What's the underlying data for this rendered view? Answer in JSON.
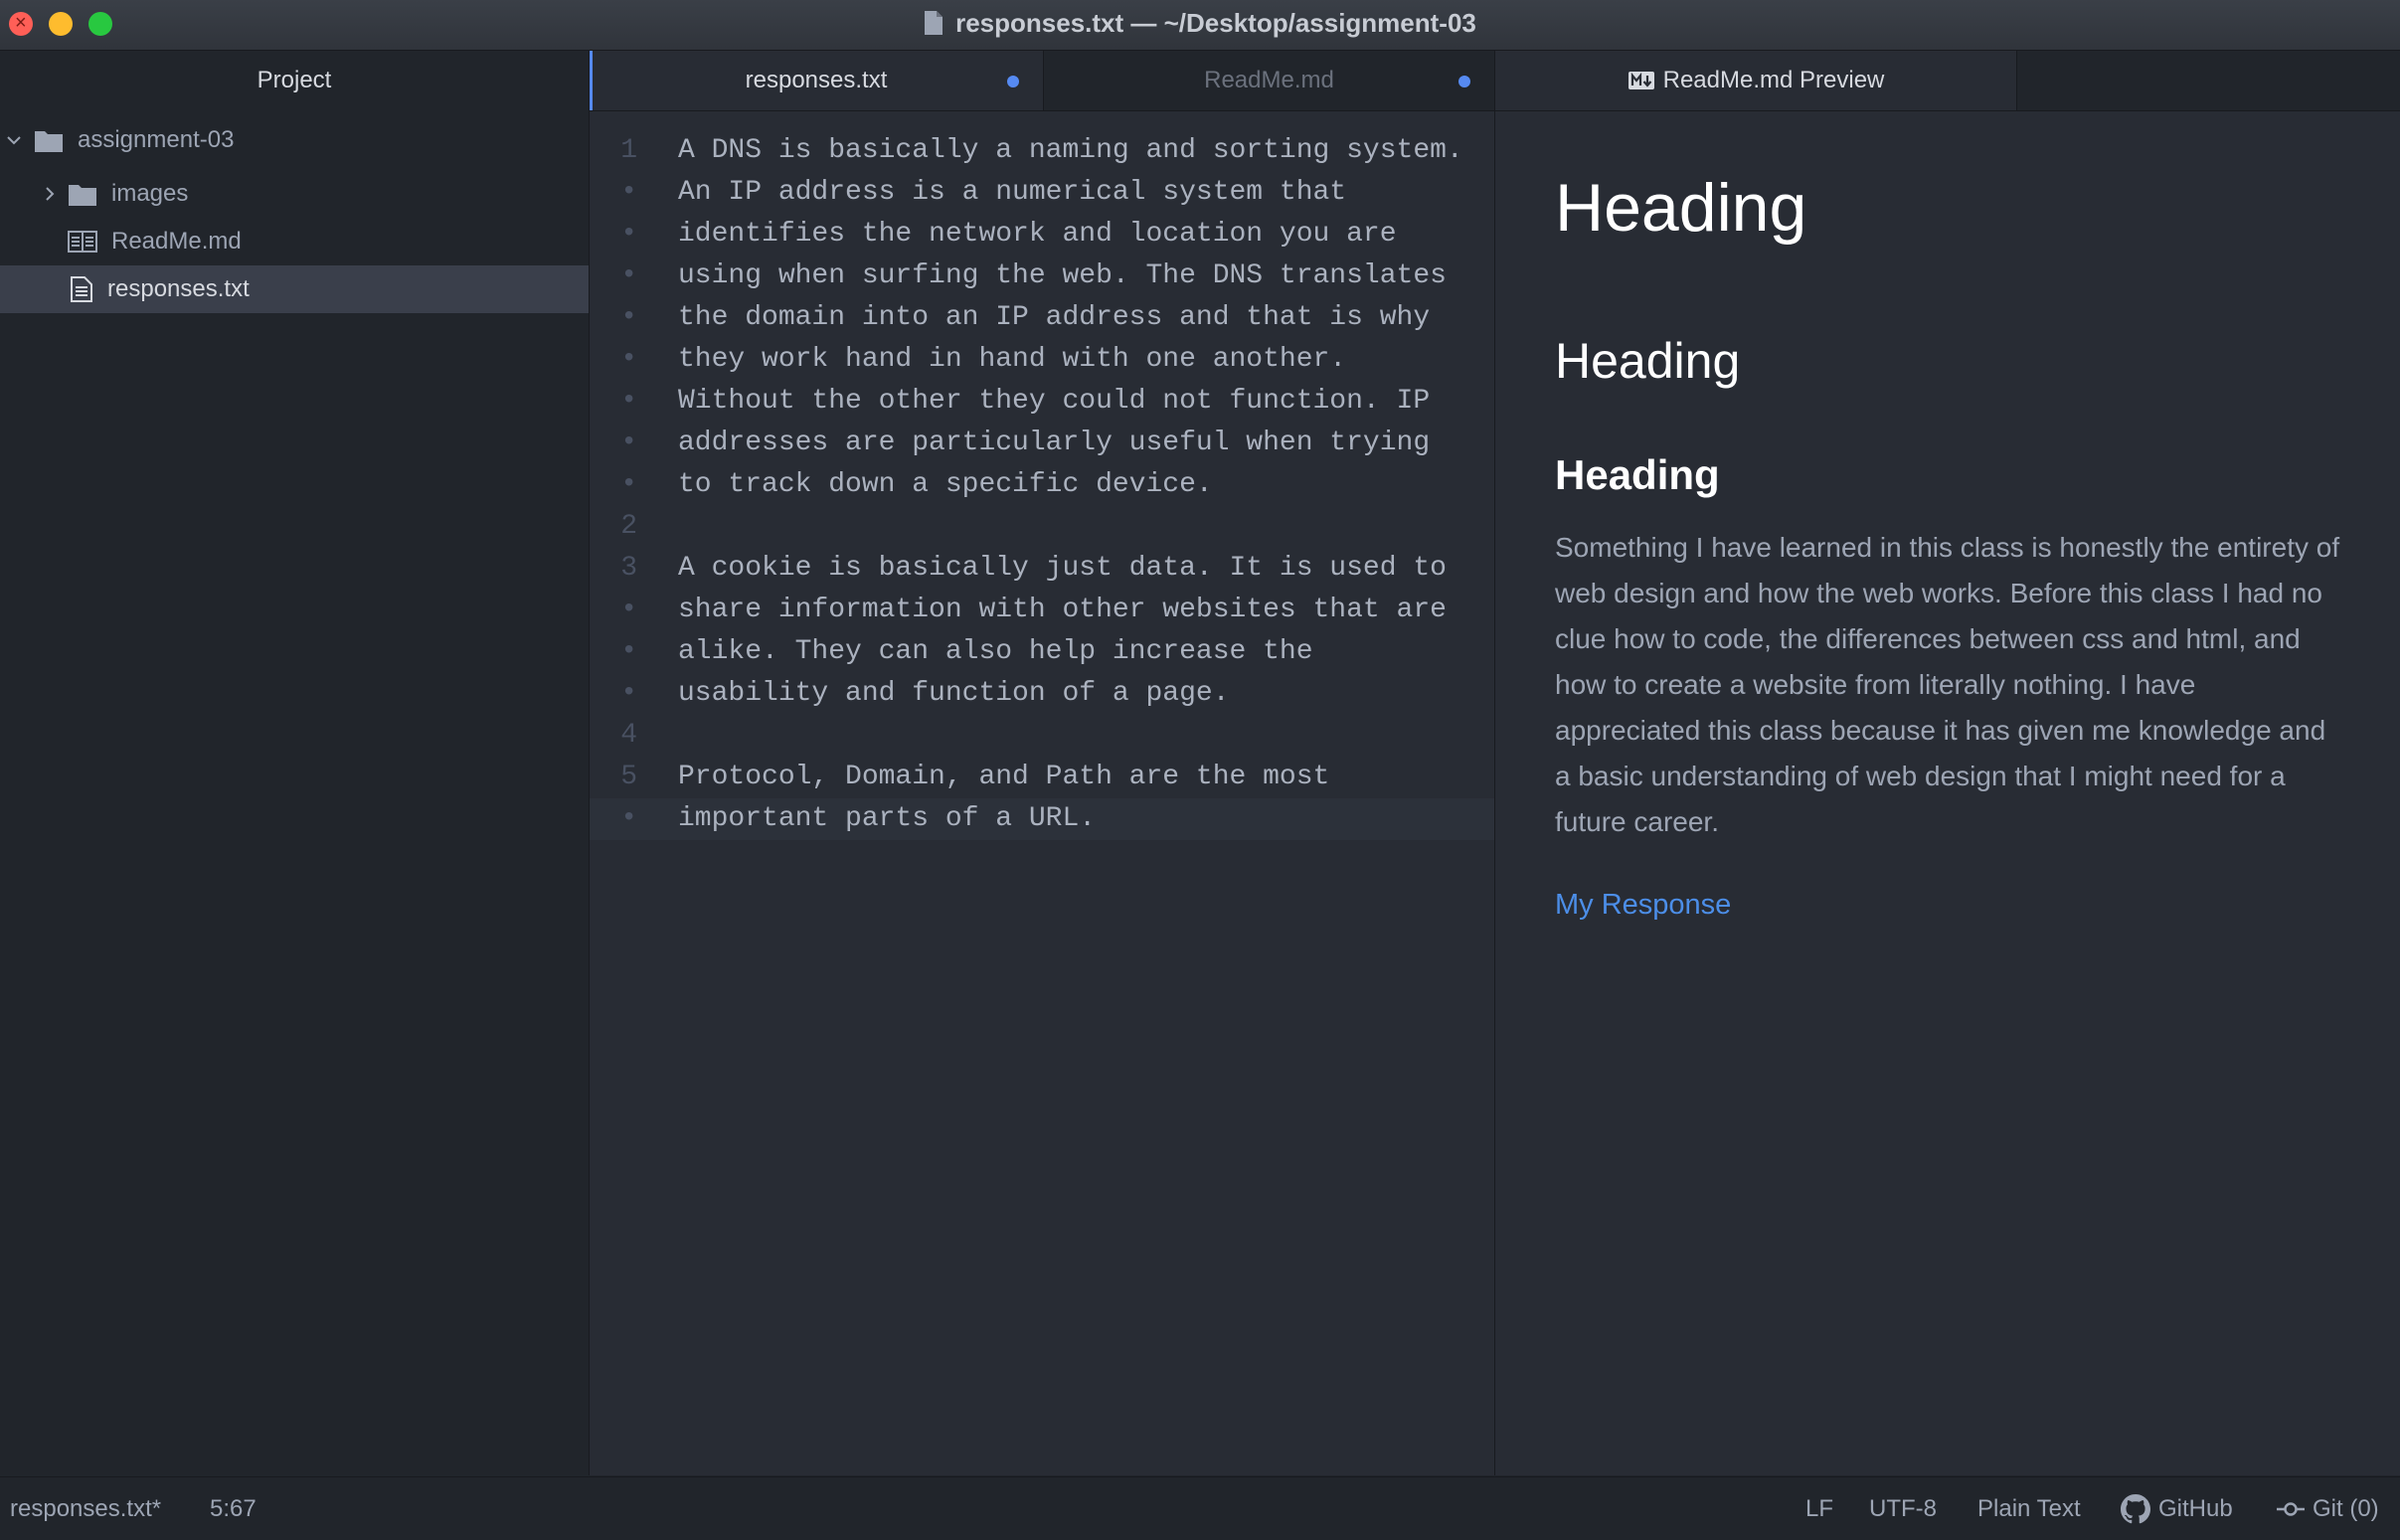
{
  "window": {
    "title": "responses.txt — ~/Desktop/assignment-03"
  },
  "sidebar": {
    "header": "Project",
    "tree": [
      {
        "label": "assignment-03",
        "type": "folder",
        "expanded": true
      },
      {
        "label": "images",
        "type": "folder",
        "expanded": false
      },
      {
        "label": "ReadMe.md",
        "type": "markdown-file"
      },
      {
        "label": "responses.txt",
        "type": "text-file",
        "selected": true
      }
    ]
  },
  "tabs": [
    {
      "label": "responses.txt",
      "modified": true,
      "active": true
    },
    {
      "label": "ReadMe.md",
      "modified": true,
      "active": false
    },
    {
      "label": "ReadMe.md Preview",
      "active": true
    }
  ],
  "editor": {
    "lines": [
      {
        "num": "1",
        "text": "A DNS is basically a naming and sorting system."
      },
      {
        "num": "•",
        "text": "An IP address is a numerical system that"
      },
      {
        "num": "•",
        "text": "identifies the network and location you are"
      },
      {
        "num": "•",
        "text": "using when surfing the web. The DNS translates"
      },
      {
        "num": "•",
        "text": "the domain into an IP address and that is why"
      },
      {
        "num": "•",
        "text": "they work hand in hand with one another."
      },
      {
        "num": "•",
        "text": "Without the other they could not function. IP"
      },
      {
        "num": "•",
        "text": "addresses are particularly useful when trying"
      },
      {
        "num": "•",
        "text": "to track down a specific device."
      },
      {
        "num": "2",
        "text": ""
      },
      {
        "num": "3",
        "text": "A cookie is basically just data. It is used to"
      },
      {
        "num": "•",
        "text": "share information with other websites that are"
      },
      {
        "num": "•",
        "text": "alike. They can also help increase the"
      },
      {
        "num": "•",
        "text": "usability and function of a page."
      },
      {
        "num": "4",
        "text": ""
      },
      {
        "num": "5",
        "text": "Protocol, Domain, and Path are the most"
      },
      {
        "num": "•",
        "text": "important parts of a URL."
      }
    ]
  },
  "preview": {
    "h1": "Heading",
    "h2": "Heading",
    "h3": "Heading",
    "paragraph": "Something I have learned in this class is honestly the entirety of web design and how the web works. Before this class I had no clue how to code, the differences between css and html, and how to create a website from literally nothing. I have appreciated this class because it has given me knowledge and a basic understanding of web design that I might need for a future career.",
    "link": "My Response"
  },
  "statusbar": {
    "file": "responses.txt*",
    "cursor": "5:67",
    "line_ending": "LF",
    "encoding": "UTF-8",
    "grammar": "Plain Text",
    "github": "GitHub",
    "git": "Git (0)"
  },
  "colors": {
    "accent": "#568af2",
    "link": "#4c8ee8",
    "background": "#282c34",
    "panel": "#21252b"
  }
}
